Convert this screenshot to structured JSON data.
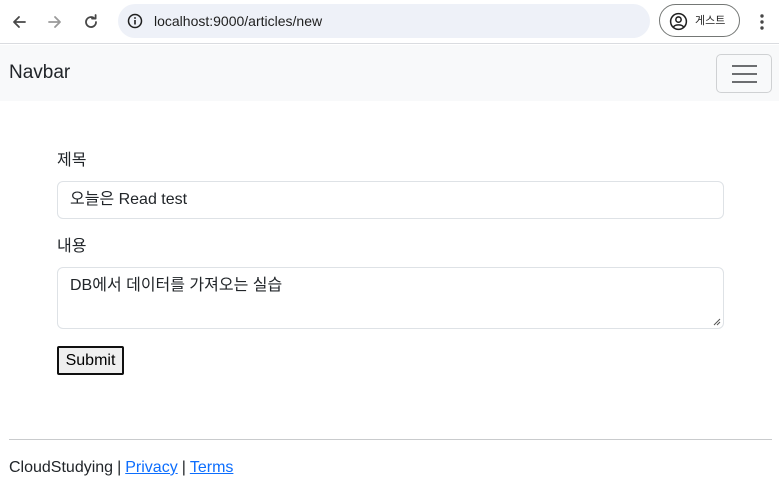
{
  "browser": {
    "url": "localhost:9000/articles/new",
    "profile_label": "게스트",
    "icons": [
      "back-arrow-icon",
      "forward-arrow-icon",
      "reload-icon",
      "site-info-icon",
      "profile-icon",
      "more-vert-icon"
    ]
  },
  "navbar": {
    "brand": "Navbar",
    "toggler_icon": "hamburger-icon"
  },
  "form": {
    "title_label": "제목",
    "title_value": "오늘은 Read test",
    "content_label": "내용",
    "content_value": "DB에서 데이터를 가져오는 실습",
    "submit_label": "Submit"
  },
  "footer": {
    "brand": "CloudStudying",
    "separator": "|",
    "privacy_link": "Privacy",
    "terms_link": "Terms",
    "link_color": "#0d6efd"
  }
}
